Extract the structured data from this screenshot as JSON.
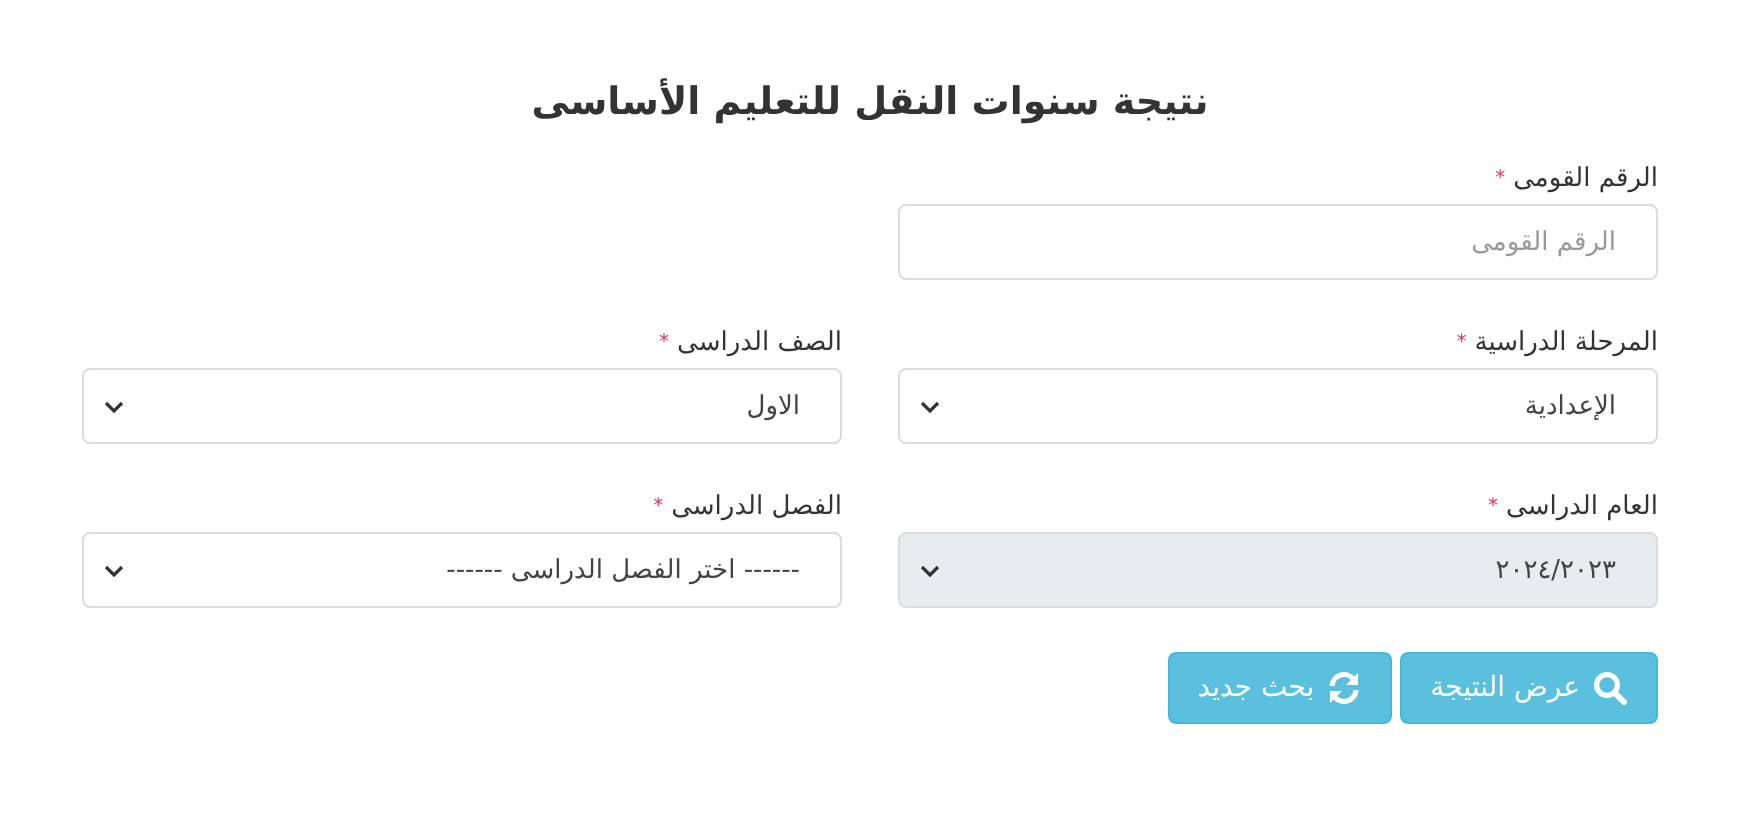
{
  "title": "نتيجة سنوات النقل للتعليم الأساسى",
  "fields": [
    {
      "kind": "input",
      "label": "الرقم القومى",
      "required_mark": "*",
      "placeholder": "الرقم القومى",
      "disabled": false
    },
    {
      "kind": "spacer"
    },
    {
      "kind": "select",
      "label": "المرحلة الدراسية",
      "required_mark": "*",
      "value": "الإعدادية",
      "disabled": false
    },
    {
      "kind": "select",
      "label": "الصف الدراسى",
      "required_mark": "*",
      "value": "الاول",
      "disabled": false
    },
    {
      "kind": "select",
      "label": "العام الدراسى",
      "required_mark": "*",
      "value": "٢٠٢٤/٢٠٢٣",
      "disabled": true
    },
    {
      "kind": "select",
      "label": "الفصل الدراسى",
      "required_mark": "*",
      "value": "------ اختر الفصل الدراسى ------",
      "disabled": false
    }
  ],
  "buttons": [
    {
      "kind": "search",
      "label": "عرض النتيجة"
    },
    {
      "kind": "refresh",
      "label": "بحث جديد"
    }
  ]
}
